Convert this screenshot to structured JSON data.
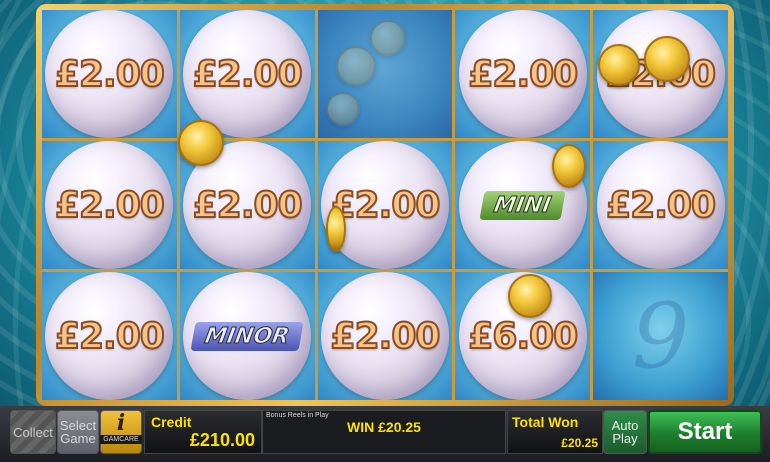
{
  "reels": {
    "cells": [
      {
        "kind": "amount",
        "label": "£2.00"
      },
      {
        "kind": "amount",
        "label": "£2.00"
      },
      {
        "kind": "empty",
        "label": ""
      },
      {
        "kind": "amount",
        "label": "£2.00"
      },
      {
        "kind": "amount",
        "label": "£2.00"
      },
      {
        "kind": "amount",
        "label": "£2.00"
      },
      {
        "kind": "amount",
        "label": "£2.00"
      },
      {
        "kind": "amount",
        "label": "£2.00"
      },
      {
        "kind": "mini",
        "label": "MINI"
      },
      {
        "kind": "amount",
        "label": "£2.00"
      },
      {
        "kind": "amount",
        "label": "£2.00"
      },
      {
        "kind": "minor",
        "label": "MINOR"
      },
      {
        "kind": "amount",
        "label": "£2.00"
      },
      {
        "kind": "amount",
        "label": "£6.00"
      },
      {
        "kind": "empty",
        "label": ""
      }
    ]
  },
  "controls": {
    "collect": "Collect",
    "select_line1": "Select",
    "select_line2": "Game",
    "info_symbol": "i",
    "info_brand": "GAMCARE",
    "credit_label": "Credit",
    "credit_value": "£210.00",
    "status_small": "Bonus Reels in Play",
    "win_text": "WIN £20.25",
    "total_won_label": "Total Won",
    "total_won_value": "£20.25",
    "auto_line1": "Auto",
    "auto_line2": "Play",
    "start": "Start"
  },
  "colors": {
    "amount_text": "#f6c38a",
    "mini_badge": "#6fb04a",
    "minor_badge": "#6f78d0",
    "start_button": "#2aa040",
    "label_yellow": "#ffe100"
  },
  "icons": [
    "info-icon",
    "gold-coin-icon",
    "pearl-icon"
  ]
}
